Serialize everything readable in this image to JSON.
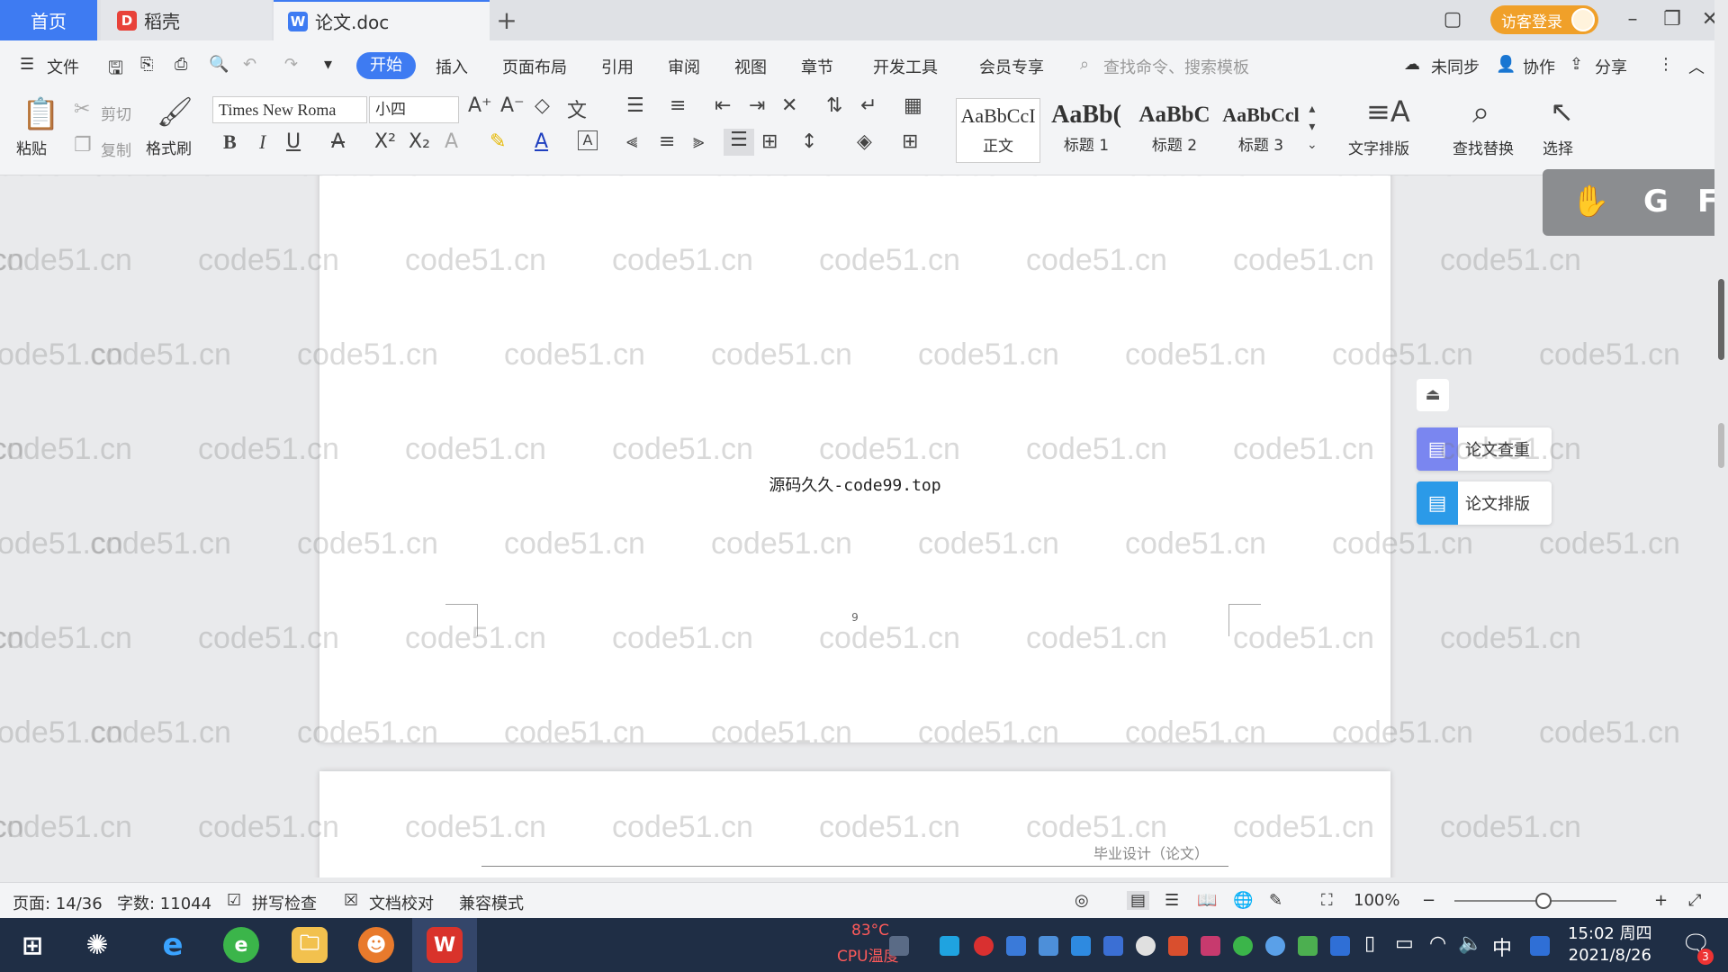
{
  "tabs": {
    "home": "首页",
    "daoke": "稻壳",
    "doc": "论文.doc"
  },
  "titlebar": {
    "login": "访客登录"
  },
  "menu": {
    "file": "文件",
    "items": [
      "开始",
      "插入",
      "页面布局",
      "引用",
      "审阅",
      "视图",
      "章节",
      "开发工具",
      "会员专享"
    ],
    "search_placeholder": "查找命令、搜索模板",
    "sync": "未同步",
    "collab": "协作",
    "share": "分享"
  },
  "ribbon": {
    "paste": "粘贴",
    "cut": "剪切",
    "copy": "复制",
    "format_painter": "格式刷",
    "font_name": "Times New Roma",
    "font_size": "小四",
    "styles": [
      {
        "preview": "AaBbCcI",
        "label": "正文"
      },
      {
        "preview": "AaBb(",
        "label": "标题 1"
      },
      {
        "preview": "AaBbC",
        "label": "标题 2"
      },
      {
        "preview": "AaBbCcl",
        "label": "标题 3"
      }
    ],
    "text_layout": "文字排版",
    "find_replace": "查找替换",
    "select": "选择"
  },
  "side": {
    "check": "论文查重",
    "layout": "论文排版"
  },
  "document": {
    "center_text": "源码久久-code99.top",
    "page_number": "9",
    "page2_header": "毕业设计（论文）"
  },
  "watermark": "code51.cn",
  "cursor_panel": {
    "g": "G",
    "f": "F"
  },
  "status": {
    "page": "页面: 14/36",
    "words": "字数: 11044",
    "spell": "拼写检查",
    "proof": "文档校对",
    "compat": "兼容模式",
    "zoom": "100%"
  },
  "taskbar": {
    "temp": "83°C",
    "cpu": "CPU温度",
    "time": "15:02 周四",
    "date": "2021/8/26",
    "notify_count": "3"
  },
  "colors": {
    "accent": "#3e7bf2",
    "login": "#f0a029",
    "taskbar": "#1f2e45"
  }
}
